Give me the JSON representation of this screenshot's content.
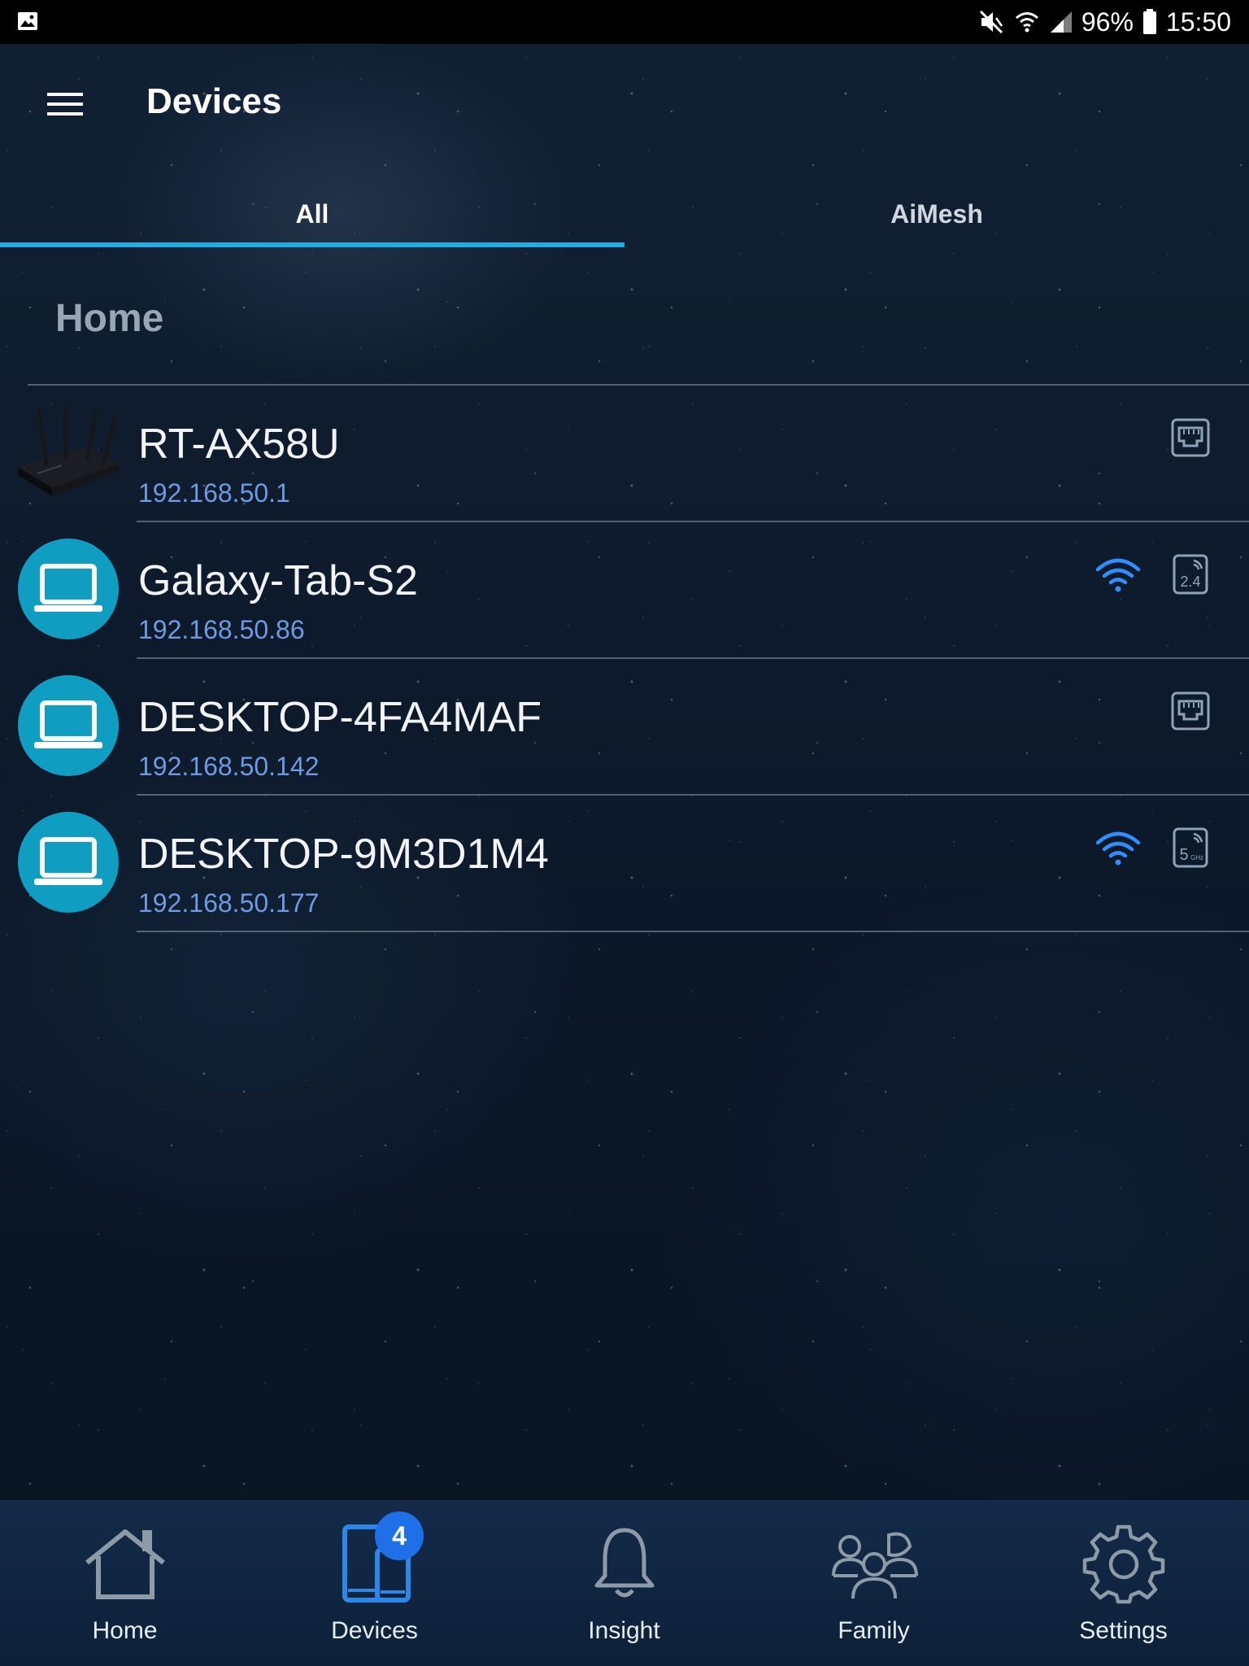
{
  "status_bar": {
    "battery": "96%",
    "time": "15:50",
    "icons": [
      "image-icon",
      "mute-icon",
      "wifi-signal-icon",
      "cell-signal-icon",
      "battery-icon"
    ]
  },
  "header": {
    "title": "Devices",
    "menu_icon": "hamburger-menu-icon"
  },
  "tabs": [
    {
      "label": "All",
      "active": true
    },
    {
      "label": "AiMesh",
      "active": false
    }
  ],
  "section": {
    "title": "Home"
  },
  "devices": [
    {
      "name": "RT-AX58U",
      "ip": "192.168.50.1",
      "type": "router",
      "connection": [
        "ethernet-icon"
      ]
    },
    {
      "name": "Galaxy-Tab-S2",
      "ip": "192.168.50.86",
      "type": "laptop",
      "connection": [
        "wifi-icon",
        "band-2.4ghz-icon"
      ],
      "band": "2.4"
    },
    {
      "name": "DESKTOP-4FA4MAF",
      "ip": "192.168.50.142",
      "type": "laptop",
      "connection": [
        "ethernet-icon"
      ]
    },
    {
      "name": "DESKTOP-9M3D1M4",
      "ip": "192.168.50.177",
      "type": "laptop",
      "connection": [
        "wifi-icon",
        "band-5ghz-icon"
      ],
      "band": "5",
      "band_unit": "GHz"
    }
  ],
  "bottom_nav": {
    "items": [
      {
        "label": "Home",
        "icon": "home-icon",
        "active": false
      },
      {
        "label": "Devices",
        "icon": "devices-icon",
        "active": true,
        "badge": "4"
      },
      {
        "label": "Insight",
        "icon": "bell-icon",
        "active": false
      },
      {
        "label": "Family",
        "icon": "family-icon",
        "active": false
      },
      {
        "label": "Settings",
        "icon": "gear-icon",
        "active": false
      }
    ]
  },
  "colors": {
    "accent": "#27a9e1",
    "active_nav": "#2e86e8",
    "avatar_bg": "#0f9ec2",
    "ip_text": "#6d9ae0",
    "wifi": "#2f8fff"
  }
}
